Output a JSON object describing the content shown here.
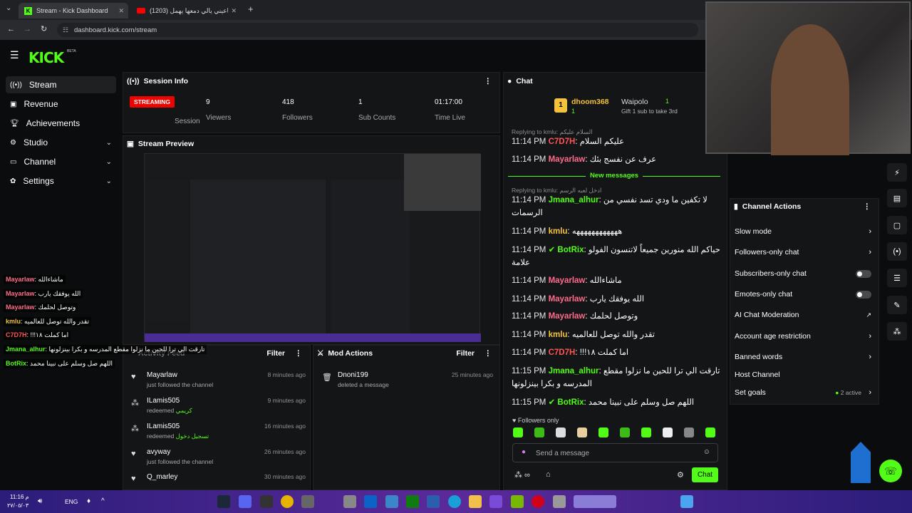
{
  "browser": {
    "tabs": [
      {
        "title": "Stream - Kick Dashboard"
      },
      {
        "title": "(1203) ياعيني يالي دمعها يهمل"
      }
    ],
    "url": "dashboard.kick.com/stream"
  },
  "app": {
    "logo": "KICK",
    "logo_beta": "BETA",
    "nav": [
      {
        "label": "Stream"
      },
      {
        "label": "Revenue"
      },
      {
        "label": "Achievements"
      },
      {
        "label": "Studio"
      },
      {
        "label": "Channel"
      },
      {
        "label": "Settings"
      }
    ]
  },
  "session": {
    "title": "Session Info",
    "status_badge": "STREAMING",
    "status_label": "Session",
    "viewers_value": "9",
    "viewers_label": "Viewers",
    "followers_value": "418",
    "followers_label": "Followers",
    "subs_value": "1",
    "subs_label": "Sub Counts",
    "time_value": "01:17:00",
    "time_label": "Time Live"
  },
  "preview": {
    "title": "Stream Preview"
  },
  "activity": {
    "title": "Activity Feed",
    "filter": "Filter",
    "items": [
      {
        "name": "Mayarlaw",
        "sub": "just followed the channel",
        "time": "8 minutes ago"
      },
      {
        "name": "ILamis505",
        "sub": "redeemed",
        "extra": "كريمي",
        "time": "9 minutes ago"
      },
      {
        "name": "ILamis505",
        "sub": "redeemed",
        "extra": "تسجيل دخول",
        "time": "16 minutes ago"
      },
      {
        "name": "avyway",
        "sub": "just followed the channel",
        "time": "26 minutes ago"
      },
      {
        "name": "Q_marley",
        "sub": "",
        "time": "30 minutes ago"
      }
    ]
  },
  "mod": {
    "title": "Mod Actions",
    "filter": "Filter",
    "item_name": "Dnoni199",
    "item_sub": "deleted a message",
    "item_time": "25 minutes ago"
  },
  "chat": {
    "title": "Chat",
    "top1_name": "dhoom368",
    "top1_count": "1",
    "top2_name": "Waipolo",
    "top2_count": "1",
    "gift_text": "Gift 1 sub to take 3rd",
    "new_messages": "New messages",
    "reply1": "Replying to kmlu: السلام عليكم",
    "reply2": "Replying to kmlu: ادخل لعبه الرسم",
    "followers_only": "Followers only",
    "placeholder": "Send a message",
    "send": "Chat",
    "lines": [
      {
        "time": "11:14 PM",
        "user": "C7D7H",
        "msg": "عليكم السلام"
      },
      {
        "time": "11:14 PM",
        "user": "Mayarlaw",
        "msg": "عرف عن نفسج بئك"
      },
      {
        "time": "11:14 PM",
        "user": "Jmana_alhur",
        "msg": "لا تكفين ما ودي تسد نفسي من الرسمات"
      },
      {
        "time": "11:14 PM",
        "user": "kmlu",
        "msg": "ههههههههههههه"
      },
      {
        "time": "11:14 PM",
        "user": "BotRix",
        "msg": "حياكم الله منورين جميعاً لاتنسون الفولو علامة"
      },
      {
        "time": "11:14 PM",
        "user": "Mayarlaw",
        "msg": "ماشاءالله"
      },
      {
        "time": "11:14 PM",
        "user": "Mayarlaw",
        "msg": "الله يوفقك يارب"
      },
      {
        "time": "11:14 PM",
        "user": "Mayarlaw",
        "msg": "وتوصل لحلمك"
      },
      {
        "time": "11:14 PM",
        "user": "kmlu",
        "msg": "تقدر والله توصل للعالميه"
      },
      {
        "time": "11:14 PM",
        "user": "C7D7H",
        "msg": "!!!اما كملت ١٨"
      },
      {
        "time": "11:15 PM",
        "user": "Jmana_alhur",
        "msg": "تارقت الي ترا للحين ما نزلوا مقطع المدرسه و بكرا بينزلونها"
      },
      {
        "time": "11:15 PM",
        "user": "BotRix",
        "msg": "اللهم صل وسلم على نبينا محمد"
      }
    ]
  },
  "actions": {
    "title": "Channel Actions",
    "items": [
      {
        "label": "Slow mode"
      },
      {
        "label": "Followers-only chat"
      },
      {
        "label": "Subscribers-only chat"
      },
      {
        "label": "Emotes-only chat"
      },
      {
        "label": "AI Chat Moderation"
      },
      {
        "label": "Account age restriction"
      },
      {
        "label": "Banned words"
      },
      {
        "label": "Host Channel"
      },
      {
        "label": "Set goals"
      }
    ],
    "goals_active": "2 active"
  },
  "overlay": {
    "lines": [
      {
        "user": "Mayarlaw",
        "msg": "ماشاءالله"
      },
      {
        "user": "Mayarlaw",
        "msg": "الله يوفقك يارب"
      },
      {
        "user": "Mayarlaw",
        "msg": "وتوصل لحلمك"
      },
      {
        "user": "kmlu",
        "msg": "تقدر والله توصل للعالميه"
      },
      {
        "user": "C7D7H",
        "msg": "!!!اما كملت ١٨"
      },
      {
        "user": "Jmana_alhur",
        "msg": "تارقت الي ترا للحين ما نزلوا مقطع المدرسه و بكرا بينزلونها"
      },
      {
        "user": "BotRix",
        "msg": "اللهم صل وسلم على نبينا محمد"
      }
    ]
  },
  "taskbar": {
    "lang": "ENG",
    "time": "11:16 م",
    "date": "٢٧/٠٥/٠٣"
  },
  "colors": {
    "brand": "#53fc18",
    "live": "#eb0400"
  }
}
